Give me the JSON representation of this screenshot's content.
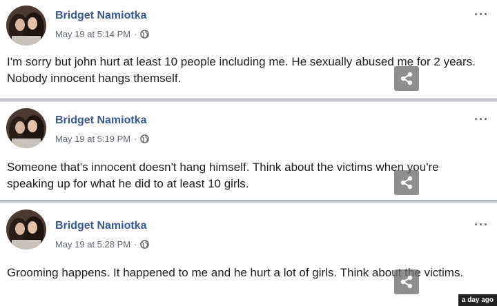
{
  "posts": [
    {
      "author": "Bridget Namiotka",
      "timestamp": "May 19 at 5:14 PM",
      "separator": "·",
      "privacy_icon": "globe-icon",
      "more": "···",
      "text": "I'm sorry but john hurt at least 10 people including me. He sexually abused me for 2 years. Nobody innocent hangs themself."
    },
    {
      "author": "Bridget Namiotka",
      "timestamp": "May 19 at 5:19 PM",
      "separator": "·",
      "privacy_icon": "globe-icon",
      "more": "···",
      "text": "Someone that's innocent doesn't hang himself. Think about the victims when you're speaking up for what he did to at least 10 girls."
    },
    {
      "author": "Bridget Namiotka",
      "timestamp": "May 19 at 5:28 PM",
      "separator": "·",
      "privacy_icon": "globe-icon",
      "more": "···",
      "text": "Grooming happens. It happened to me and he hurt a lot of girls. Think about the victims."
    }
  ],
  "badge": "a day ago",
  "colors": {
    "author": "#385898",
    "meta": "#606770",
    "text": "#1c1e21",
    "divider": "#c9ccd1"
  }
}
